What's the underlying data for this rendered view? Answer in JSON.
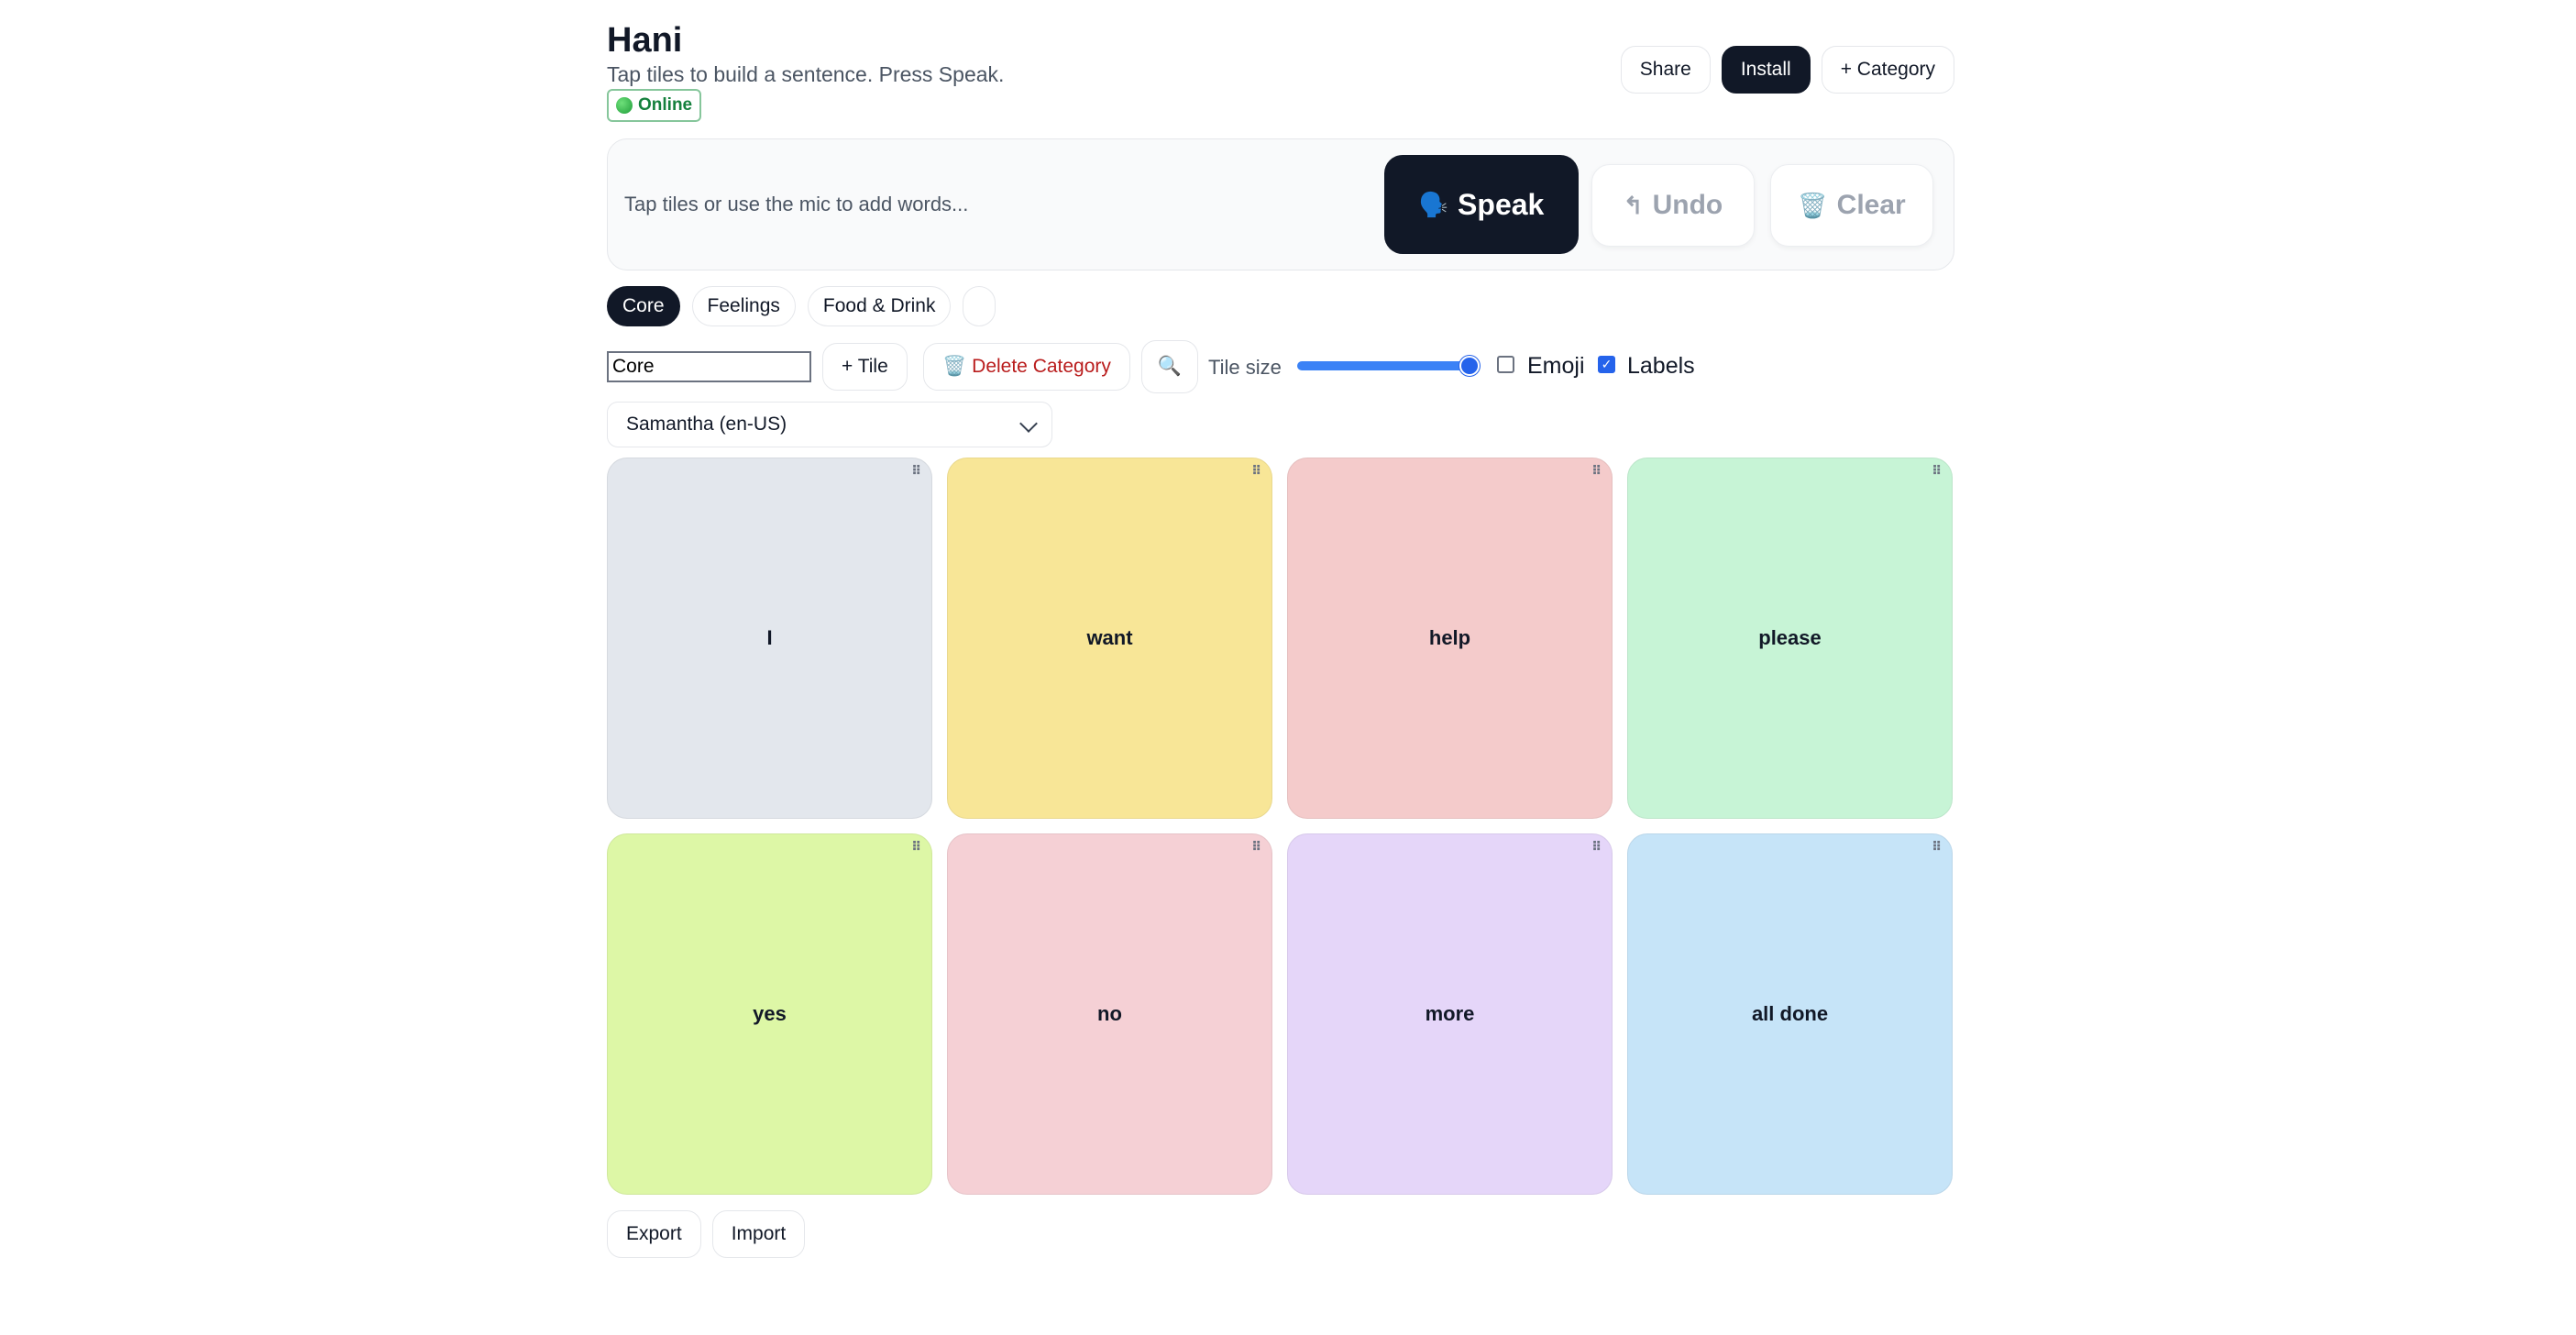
{
  "header": {
    "title": "Hani",
    "subtitle": "Tap tiles to build a sentence. Press Speak.",
    "status": "Online",
    "share_label": "Share",
    "install_label": "Install",
    "add_category_label": "+ Category"
  },
  "sentence": {
    "placeholder": "Tap tiles or use the mic to add words...",
    "speak_label": "Speak",
    "undo_label": "Undo",
    "clear_label": "Clear"
  },
  "categories": [
    {
      "label": "Core",
      "active": true
    },
    {
      "label": "Feelings",
      "active": false
    },
    {
      "label": "Food & Drink",
      "active": false
    },
    {
      "label": "",
      "active": false
    }
  ],
  "tools": {
    "category_name_value": "Core",
    "add_tile_label": "+ Tile",
    "delete_category_label": "Delete Category",
    "tile_size_label": "Tile size",
    "tile_size_value_percent": 100,
    "emoji_label": "Emoji",
    "emoji_checked": false,
    "labels_label": "Labels",
    "labels_checked": true
  },
  "voice": {
    "selected": "Samantha (en-US)"
  },
  "tiles": [
    {
      "label": "I",
      "color": "#e3e7ed"
    },
    {
      "label": "want",
      "color": "#f8e697"
    },
    {
      "label": "help",
      "color": "#f4cbcb"
    },
    {
      "label": "please",
      "color": "#c7f4d6"
    },
    {
      "label": "yes",
      "color": "#ddf7a6"
    },
    {
      "label": "no",
      "color": "#f5d0d5"
    },
    {
      "label": "more",
      "color": "#e5d6f9"
    },
    {
      "label": "all done",
      "color": "#c6e4f8"
    }
  ],
  "footer": {
    "export_label": "Export",
    "import_label": "Import"
  },
  "colors": {
    "accent": "#111827",
    "danger": "#b91c1c",
    "online": "#15803d",
    "slider": "#3b82f6"
  }
}
